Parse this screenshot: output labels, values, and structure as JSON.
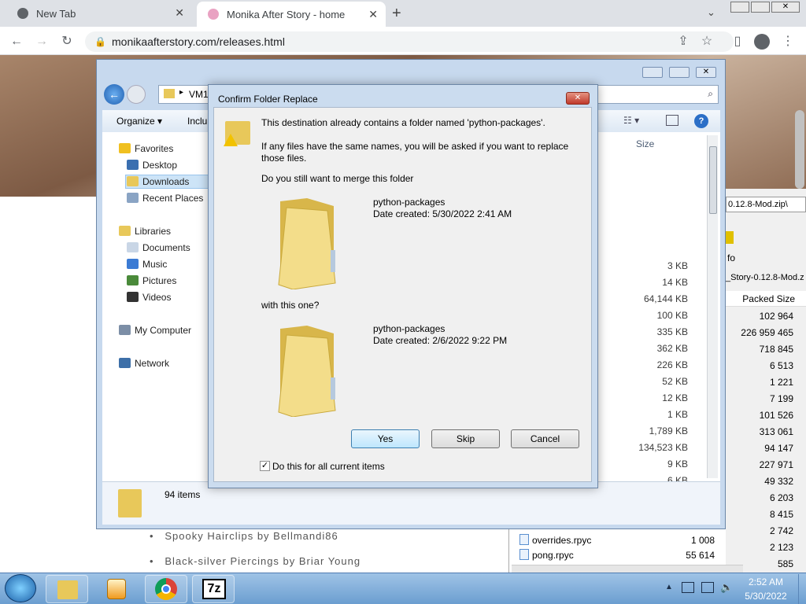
{
  "browser": {
    "tabs": [
      {
        "label": "New Tab"
      },
      {
        "label": "Monika After Story - home"
      }
    ],
    "url": "monikaafterstory.com/releases.html"
  },
  "page": {
    "list_items": [
      "Spooky Hairclips by Bellmandi86",
      "Black-silver Piercings by Briar Young"
    ]
  },
  "explorer": {
    "address": "VM1",
    "toolbar": {
      "organize": "Organize",
      "include": "Inclu"
    },
    "nav": {
      "favorites": "Favorites",
      "desktop": "Desktop",
      "downloads": "Downloads",
      "recent": "Recent Places",
      "libraries": "Libraries",
      "documents": "Documents",
      "music": "Music",
      "pictures": "Pictures",
      "videos": "Videos",
      "computer": "My Computer",
      "network": "Network"
    },
    "size_header": "Size",
    "sizes": [
      "3 KB",
      "14 KB",
      "64,144 KB",
      "100 KB",
      "335 KB",
      "362 KB",
      "226 KB",
      "52 KB",
      "12 KB",
      "1 KB",
      "1,789 KB",
      "134,523 KB",
      "9 KB",
      "6 KB"
    ],
    "status": "94 items"
  },
  "zip": {
    "path_tail": "0.12.8-Mod.zip\\",
    "info": "fo",
    "archive": "_Story-0.12.8-Mod.z",
    "header": "Packed Size",
    "packed": [
      "102 964",
      "226 959 465",
      "718 845",
      "6 513",
      "1 221",
      "7 199",
      "101 526",
      "313 061",
      "94 147",
      "227 971",
      "49 332",
      "6 203",
      "8 415",
      "2 742",
      "2 123",
      "585",
      "55 614"
    ],
    "files": [
      {
        "name": "overrides.rpyc",
        "size": "1 008"
      },
      {
        "name": "pong.rpyc",
        "size": "55 614"
      }
    ]
  },
  "dialog": {
    "title": "Confirm Folder Replace",
    "line1": "This destination already contains a folder named 'python-packages'.",
    "line2": "If any files have the same names, you will be asked if you want to replace",
    "line3": "those files.",
    "question": "Do you still want to merge this folder",
    "folder1_name": "python-packages",
    "folder1_date": "Date created: 5/30/2022 2:41 AM",
    "with": "with this one?",
    "folder2_name": "python-packages",
    "folder2_date": "Date created: 2/6/2022 9:22 PM",
    "yes": "Yes",
    "skip": "Skip",
    "cancel": "Cancel",
    "checkbox": "Do this for all current items",
    "checked": true
  },
  "taskbar": {
    "time": "2:52 AM",
    "date": "5/30/2022",
    "app_7z": "7z"
  },
  "colors": {
    "accent": "#3a8fd6",
    "folder": "#e8c85a"
  }
}
